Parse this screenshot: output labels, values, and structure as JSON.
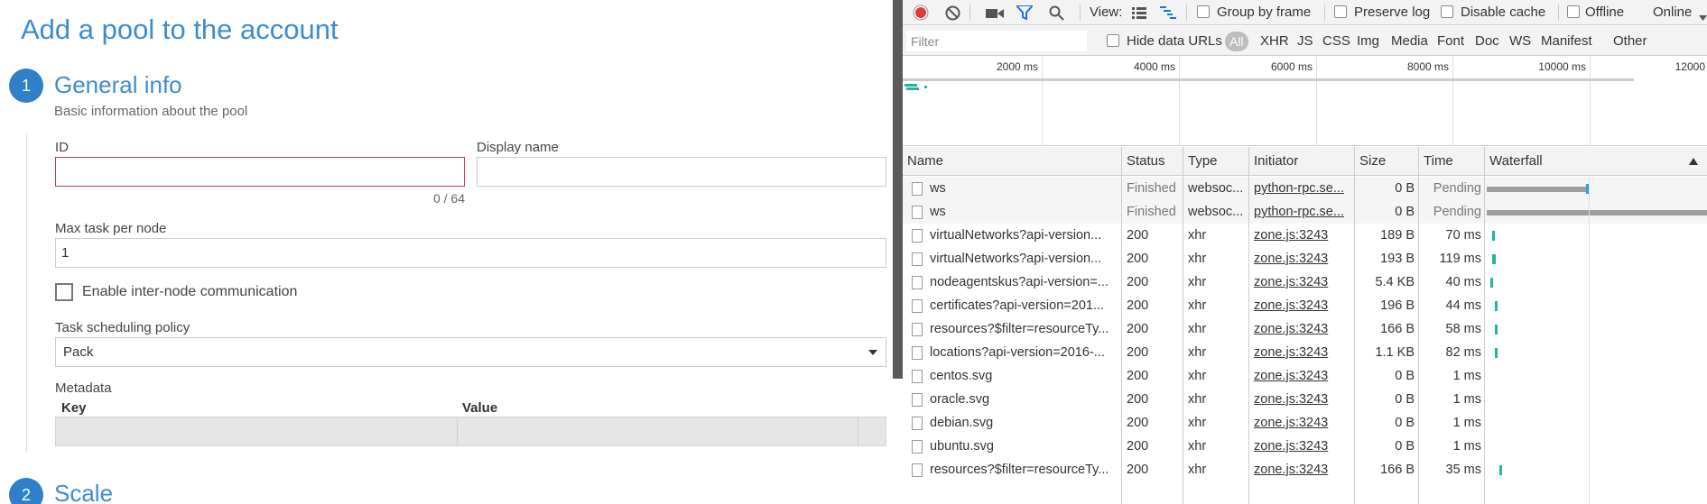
{
  "form": {
    "title": "Add a pool to the account",
    "step1": {
      "number": "1",
      "title": "General info",
      "subtitle": "Basic information about the pool"
    },
    "id": {
      "label": "ID",
      "value": "",
      "counter": "0 / 64"
    },
    "display_name": {
      "label": "Display name",
      "value": ""
    },
    "max_task": {
      "label": "Max task per node",
      "value": "1"
    },
    "inter_node": {
      "label": "Enable inter-node communication",
      "checked": false
    },
    "scheduling": {
      "label": "Task scheduling policy",
      "value": "Pack"
    },
    "metadata": {
      "label": "Metadata",
      "key_header": "Key",
      "value_header": "Value"
    },
    "step2": {
      "number": "2",
      "title": "Scale"
    }
  },
  "devtools": {
    "toolbar": {
      "view_label": "View:",
      "group_by_frame": "Group by frame",
      "preserve_log": "Preserve log",
      "disable_cache": "Disable cache",
      "offline": "Offline",
      "throttle": "Online"
    },
    "filterbar": {
      "filter_placeholder": "Filter",
      "hide_data_urls": "Hide data URLs",
      "types": [
        "All",
        "XHR",
        "JS",
        "CSS",
        "Img",
        "Media",
        "Font",
        "Doc",
        "WS",
        "Manifest",
        "Other"
      ]
    },
    "overview_ticks": [
      "2000 ms",
      "4000 ms",
      "6000 ms",
      "8000 ms",
      "10000 ms",
      "12000"
    ],
    "columns": {
      "name": "Name",
      "status": "Status",
      "type": "Type",
      "initiator": "Initiator",
      "size": "Size",
      "time": "Time",
      "waterfall": "Waterfall"
    },
    "requests": [
      {
        "name": "ws",
        "status": "Finished",
        "type": "websoc...",
        "initiator": "python-rpc.se...",
        "size": "0 B",
        "time": "Pending"
      },
      {
        "name": "ws",
        "status": "Finished",
        "type": "websoc...",
        "initiator": "python-rpc.se...",
        "size": "0 B",
        "time": "Pending"
      },
      {
        "name": "virtualNetworks?api-version...",
        "status": "200",
        "type": "xhr",
        "initiator": "zone.js:3243",
        "size": "189 B",
        "time": "70 ms"
      },
      {
        "name": "virtualNetworks?api-version...",
        "status": "200",
        "type": "xhr",
        "initiator": "zone.js:3243",
        "size": "193 B",
        "time": "119 ms"
      },
      {
        "name": "nodeagentskus?api-version=...",
        "status": "200",
        "type": "xhr",
        "initiator": "zone.js:3243",
        "size": "5.4 KB",
        "time": "40 ms"
      },
      {
        "name": "certificates?api-version=201...",
        "status": "200",
        "type": "xhr",
        "initiator": "zone.js:3243",
        "size": "196 B",
        "time": "44 ms"
      },
      {
        "name": "resources?$filter=resourceTy...",
        "status": "200",
        "type": "xhr",
        "initiator": "zone.js:3243",
        "size": "166 B",
        "time": "58 ms"
      },
      {
        "name": "locations?api-version=2016-...",
        "status": "200",
        "type": "xhr",
        "initiator": "zone.js:3243",
        "size": "1.1 KB",
        "time": "82 ms"
      },
      {
        "name": "centos.svg",
        "status": "200",
        "type": "xhr",
        "initiator": "zone.js:3243",
        "size": "0 B",
        "time": "1 ms"
      },
      {
        "name": "oracle.svg",
        "status": "200",
        "type": "xhr",
        "initiator": "zone.js:3243",
        "size": "0 B",
        "time": "1 ms"
      },
      {
        "name": "debian.svg",
        "status": "200",
        "type": "xhr",
        "initiator": "zone.js:3243",
        "size": "0 B",
        "time": "1 ms"
      },
      {
        "name": "ubuntu.svg",
        "status": "200",
        "type": "xhr",
        "initiator": "zone.js:3243",
        "size": "0 B",
        "time": "1 ms"
      },
      {
        "name": "resources?$filter=resourceTy...",
        "status": "200",
        "type": "xhr",
        "initiator": "zone.js:3243",
        "size": "166 B",
        "time": "35 ms"
      }
    ],
    "colors": {
      "record": "#e53935",
      "accent": "#1a73e8",
      "waterfall_receive": "#1fb5a0",
      "waterfall_wait": "#9e9e9e"
    }
  }
}
